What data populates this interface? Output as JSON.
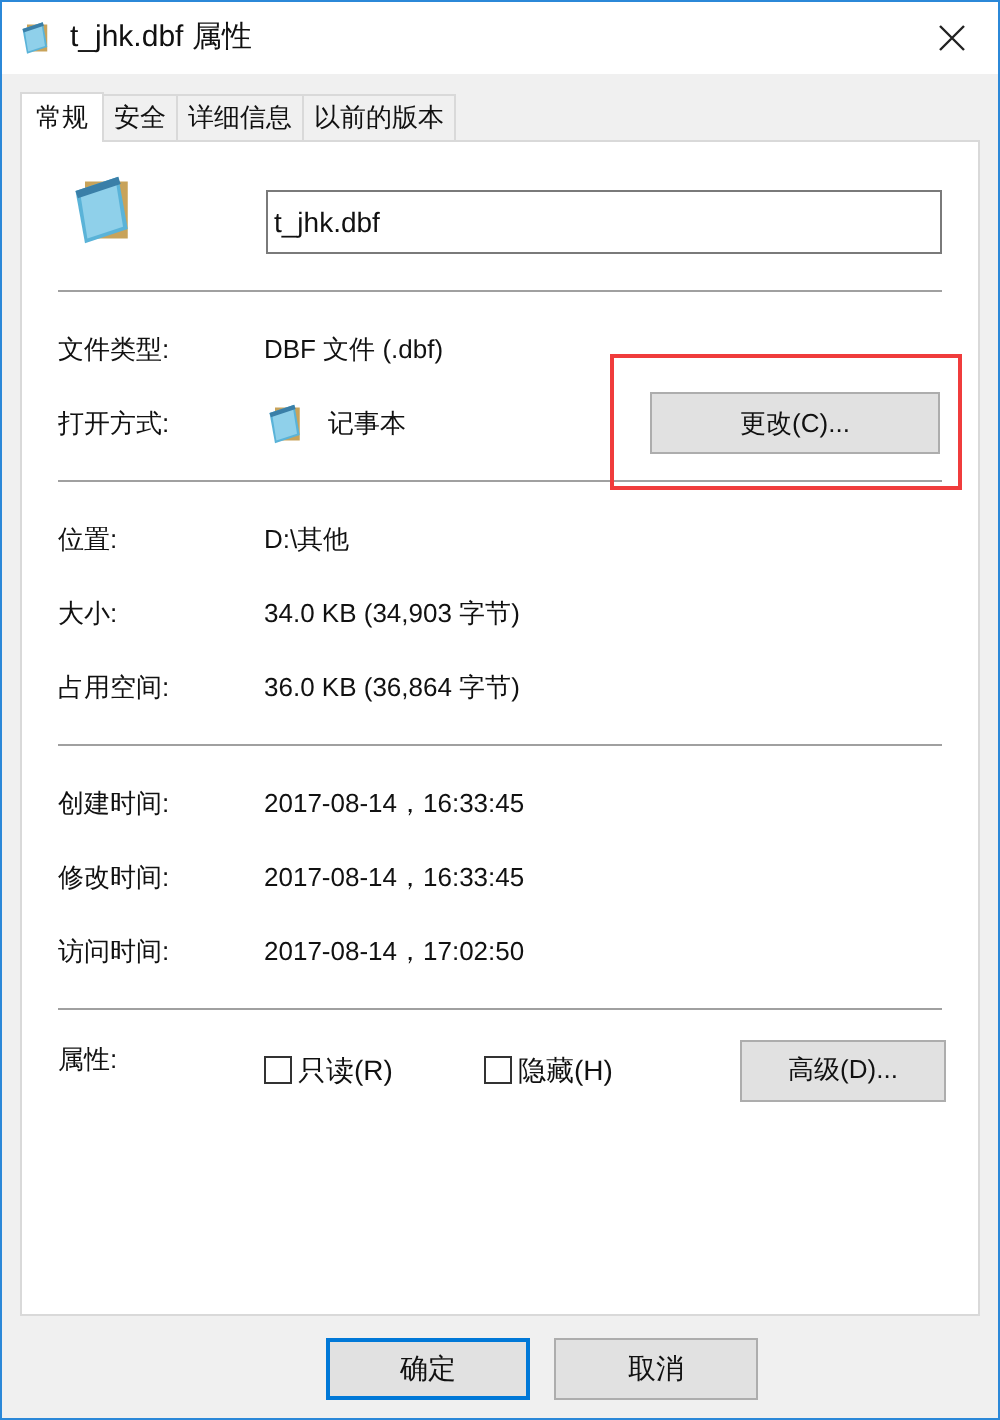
{
  "window": {
    "title": "t_jhk.dbf 属性"
  },
  "tabs": [
    {
      "label": "常规",
      "selected": true
    },
    {
      "label": "安全",
      "selected": false
    },
    {
      "label": "详细信息",
      "selected": false
    },
    {
      "label": "以前的版本",
      "selected": false
    }
  ],
  "file_name": {
    "value": "t_jhk.dbf"
  },
  "sections": [
    [
      {
        "kind": "text",
        "label": "文件类型:",
        "value": "DBF 文件 (.dbf)"
      },
      {
        "kind": "app",
        "label": "打开方式:",
        "value": "记事本",
        "button": "更改(C)...",
        "highlighted": true
      }
    ],
    [
      {
        "kind": "text",
        "label": "位置:",
        "value": "D:\\其他"
      },
      {
        "kind": "text",
        "label": "大小:",
        "value": "34.0 KB (34,903 字节)"
      },
      {
        "kind": "text",
        "label": "占用空间:",
        "value": "36.0 KB (36,864 字节)"
      }
    ],
    [
      {
        "kind": "text",
        "label": "创建时间:",
        "value": "2017-08-14，16:33:45"
      },
      {
        "kind": "text",
        "label": "修改时间:",
        "value": "2017-08-14，16:33:45"
      },
      {
        "kind": "text",
        "label": "访问时间:",
        "value": "2017-08-14，17:02:50"
      }
    ]
  ],
  "attributes": {
    "label": "属性:",
    "checkboxes": [
      {
        "label": "只读(R)",
        "checked": false
      },
      {
        "label": "隐藏(H)",
        "checked": false
      }
    ],
    "button": "高级(D)..."
  },
  "buttons": [
    {
      "label": "确定",
      "default": true
    },
    {
      "label": "取消",
      "default": false
    }
  ]
}
